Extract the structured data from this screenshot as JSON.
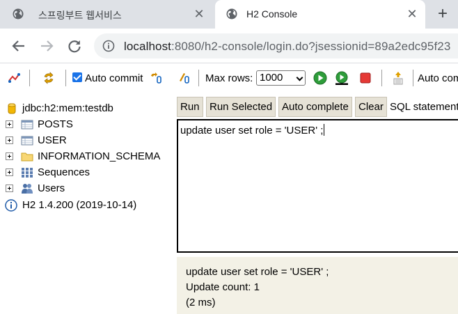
{
  "browser": {
    "tabs": [
      {
        "title": "스프링부트 웹서비스",
        "active": false,
        "icon": "globe-icon"
      },
      {
        "title": "H2 Console",
        "active": true,
        "icon": "globe-icon"
      }
    ],
    "close_glyph": "✕",
    "new_tab_glyph": "+",
    "url_host": "localhost",
    "url_rest": ":8080/h2-console/login.do?jsessionid=89a2edc95f23"
  },
  "toolbar": {
    "auto_commit_label": "Auto commit",
    "auto_commit_checked": true,
    "max_rows_label": "Max rows:",
    "max_rows_value": "1000",
    "auto_complete_label": "Auto com"
  },
  "tree": {
    "connection": "jdbc:h2:mem:testdb",
    "items": [
      {
        "label": "POSTS",
        "icon": "table-icon"
      },
      {
        "label": "USER",
        "icon": "table-icon"
      },
      {
        "label": "INFORMATION_SCHEMA",
        "icon": "folder-icon"
      },
      {
        "label": "Sequences",
        "icon": "sequences-icon"
      },
      {
        "label": "Users",
        "icon": "users-icon"
      }
    ],
    "version": "H2 1.4.200 (2019-10-14)"
  },
  "sql": {
    "buttons": {
      "run": "Run",
      "run_selected": "Run Selected",
      "auto_complete": "Auto complete",
      "clear": "Clear"
    },
    "statement_label": "SQL statement",
    "editor_text": "update user set role = 'USER' ;"
  },
  "result": {
    "statement": "update user set role = 'USER' ;",
    "update_count": "Update count: 1",
    "time": "(2 ms)"
  },
  "colors": {
    "tab_strip": "#dee1e6",
    "omnibox": "#f1f3f4",
    "button_bg": "#e6e2d6",
    "result_bg": "#f3f1e6",
    "checkbox": "#1a73e8"
  }
}
